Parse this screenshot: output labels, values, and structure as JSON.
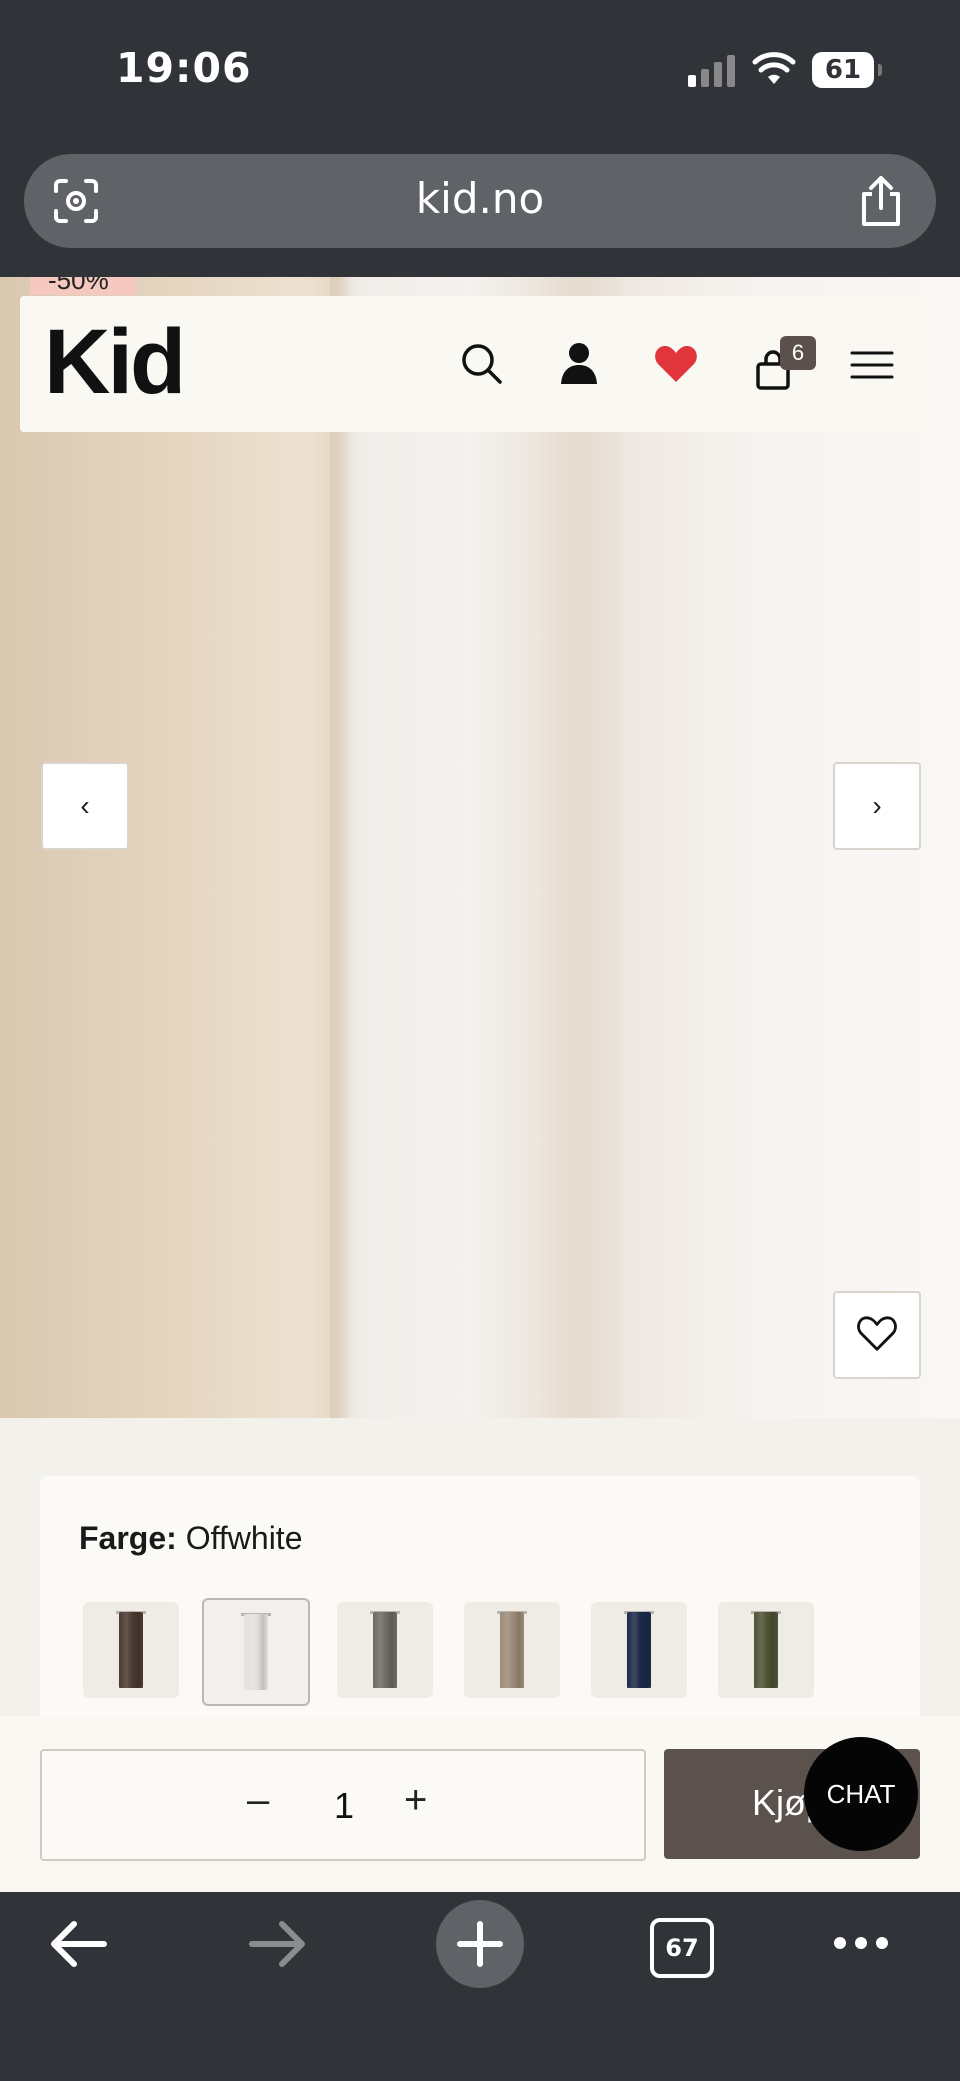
{
  "status_bar": {
    "time": "19:06",
    "battery": "61"
  },
  "browser": {
    "url": "kid.no",
    "tabs_count": "67"
  },
  "store": {
    "logo": "Kid",
    "sale_badge": "-50%",
    "cart_count": "6",
    "header_icons": [
      "search-icon",
      "account-icon",
      "heart-icon",
      "cart-icon",
      "menu-icon"
    ],
    "accent_colors": {
      "favorite": "#e0353b",
      "buy_button": "#5b524d",
      "badge": "#f5c9bf"
    }
  },
  "gallery": {
    "prev_symbol": "‹",
    "next_symbol": "›"
  },
  "product": {
    "color_label": "Farge:",
    "color_value": "Offwhite",
    "swatches": [
      {
        "name": "brown",
        "color": "#4a3a30",
        "selected": false
      },
      {
        "name": "offwhite",
        "color": "#e4e1dc",
        "selected": true
      },
      {
        "name": "grey",
        "color": "#6f6963",
        "selected": false
      },
      {
        "name": "beige",
        "color": "#9c8a76",
        "selected": false
      },
      {
        "name": "navy",
        "color": "#1c2a4a",
        "selected": false
      },
      {
        "name": "olive",
        "color": "#4e5236",
        "selected": false
      }
    ]
  },
  "purchase": {
    "quantity": "1",
    "minus": "–",
    "plus": "+",
    "buy_label": "Kjøp",
    "chat_label": "CHAT"
  }
}
